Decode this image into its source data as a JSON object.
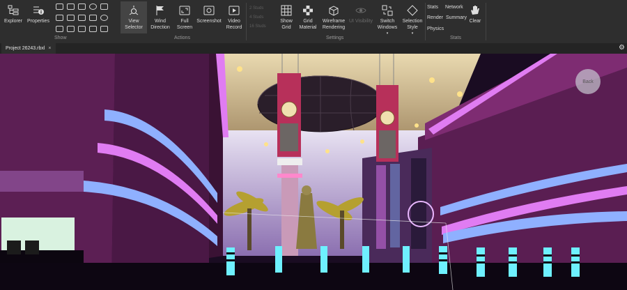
{
  "ribbon": {
    "explorer": "Explorer",
    "properties": "Properties",
    "view_selector": "View Selector",
    "wind_direction": "Wind Direction",
    "full_screen": "Full Screen",
    "screenshot": "Screenshot",
    "video_record": "Video Record",
    "studs_2": "2 Studs",
    "studs_4": "4 Studs",
    "studs_16": "16 Studs",
    "show_grid": "Show Grid",
    "grid_material": "Grid Material",
    "wireframe_rendering": "Wireframe Rendering",
    "ui_visibility": "UI Visibility",
    "switch_windows": "Switch Windows",
    "selection_style": "Selection Style",
    "stats": "Stats",
    "network": "Network",
    "render": "Render",
    "summary": "Summary",
    "physics": "Physics",
    "clear": "Clear",
    "groups": {
      "show": "Show",
      "actions": "Actions",
      "settings": "Settings",
      "stats": "Stats"
    }
  },
  "tab": {
    "label": "Project 26243.rbxl",
    "close": "×"
  },
  "viewport": {
    "back_label": "Back"
  },
  "colors": {
    "ribbon_bg": "#2e2e2e",
    "neon_blue": "#8fb0ff",
    "neon_pink": "#e07cf2",
    "wall_purple": "#5a1e52"
  }
}
